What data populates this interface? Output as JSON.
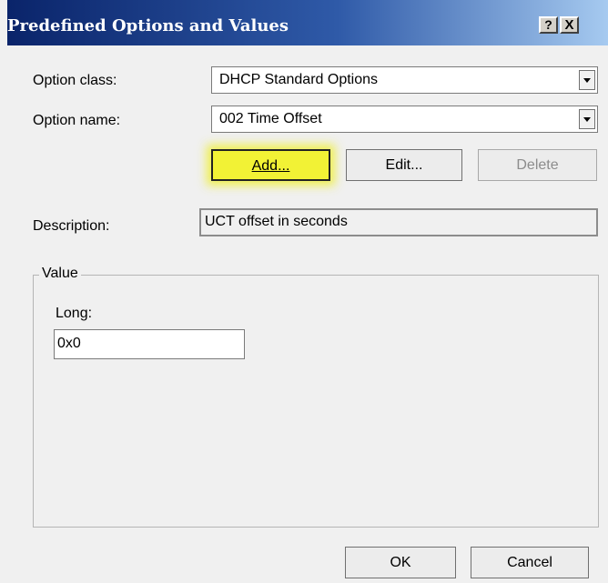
{
  "window": {
    "title": "Predefined Options and Values",
    "help_glyph": "?",
    "close_glyph": "X"
  },
  "option_class": {
    "label": "Option class:",
    "value": "DHCP Standard Options"
  },
  "option_name": {
    "label": "Option name:",
    "value": "002 Time Offset"
  },
  "actions": {
    "add_label": "Add...",
    "edit_label": "Edit...",
    "delete_label": "Delete"
  },
  "description": {
    "label": "Description:",
    "value": "UCT offset in seconds"
  },
  "value_group": {
    "title": "Value",
    "long_label": "Long:",
    "long_value": "0x0"
  },
  "footer": {
    "ok_label": "OK",
    "cancel_label": "Cancel"
  },
  "colors": {
    "titlebar_start": "#0a246a",
    "titlebar_end": "#a6caf0",
    "highlight": "#f2f235",
    "dialog_bg": "#f0f0f0"
  }
}
